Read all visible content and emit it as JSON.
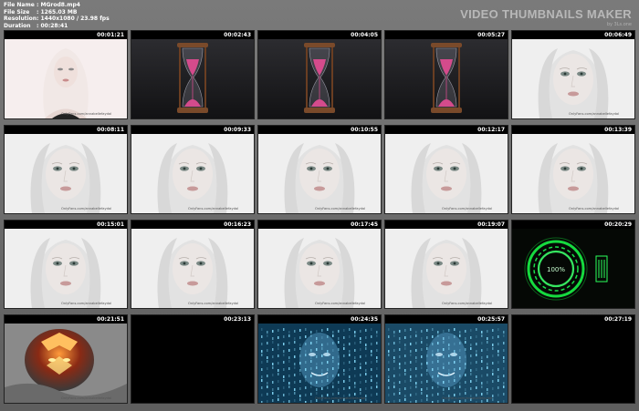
{
  "file_info": [
    {
      "label": "File Name",
      "value": ": MGrod8.mp4"
    },
    {
      "label": "File Size",
      "value": ": 1265.03 MB"
    },
    {
      "label": "Resolution",
      "value": ": 1440x1080 / 23.98 fps"
    },
    {
      "label": "Duration",
      "value": ": 00:28:41"
    }
  ],
  "brand": {
    "title": "VIDEO THUMBNAILS MAKER",
    "subtitle": "by 3Ls.one"
  },
  "watermark": "OnlyFans.com/annabellefaydal",
  "thumbnails": [
    {
      "time": "00:01:21",
      "scene": "woman-portrait-bright",
      "watermark": true
    },
    {
      "time": "00:02:43",
      "scene": "hourglass",
      "watermark": false
    },
    {
      "time": "00:04:05",
      "scene": "hourglass",
      "watermark": false
    },
    {
      "time": "00:05:27",
      "scene": "hourglass",
      "watermark": false
    },
    {
      "time": "00:06:49",
      "scene": "face-closeup",
      "watermark": true
    },
    {
      "time": "00:08:11",
      "scene": "face-closeup",
      "watermark": true
    },
    {
      "time": "00:09:33",
      "scene": "face-closeup",
      "watermark": true
    },
    {
      "time": "00:10:55",
      "scene": "face-closeup",
      "watermark": true
    },
    {
      "time": "00:12:17",
      "scene": "face-closeup",
      "watermark": true
    },
    {
      "time": "00:13:39",
      "scene": "face-closeup",
      "watermark": true
    },
    {
      "time": "00:15:01",
      "scene": "face-closeup",
      "watermark": true
    },
    {
      "time": "00:16:23",
      "scene": "face-closeup",
      "watermark": true
    },
    {
      "time": "00:17:45",
      "scene": "face-closeup",
      "watermark": true
    },
    {
      "time": "00:19:07",
      "scene": "face-closeup",
      "watermark": true
    },
    {
      "time": "00:20:29",
      "scene": "green-loading-ring",
      "watermark": false,
      "ring_text": "100%"
    },
    {
      "time": "00:21:51",
      "scene": "fire-face",
      "watermark": true
    },
    {
      "time": "00:23:13",
      "scene": "black",
      "watermark": false
    },
    {
      "time": "00:24:35",
      "scene": "matrix-face",
      "watermark": true
    },
    {
      "time": "00:25:57",
      "scene": "matrix-face",
      "watermark": true
    },
    {
      "time": "00:27:19",
      "scene": "black",
      "watermark": false
    }
  ]
}
